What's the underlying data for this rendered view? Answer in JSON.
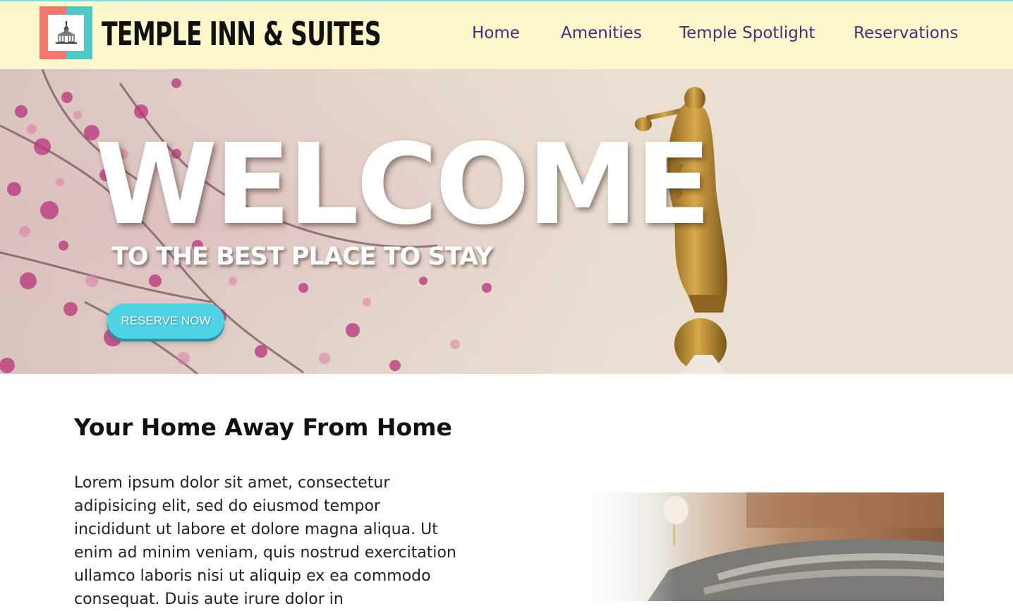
{
  "header": {
    "brand": "TEMPLE INN & SUITES",
    "logo_icon": "temple-icon",
    "nav": [
      {
        "label": "Home"
      },
      {
        "label": "Amenities"
      },
      {
        "label": "Temple Spotlight"
      },
      {
        "label": "Reservations"
      }
    ]
  },
  "hero": {
    "headline": "WELCOME",
    "tagline": "TO THE BEST PLACE TO STAY",
    "cta_label": "RESERVE NOW"
  },
  "intro": {
    "title": "Your Home Away From Home",
    "body": "Lorem ipsum dolor sit amet, consectetur adipisicing elit, sed do eiusmod tempor incididunt ut labore et dolore magna aliqua. Ut enim ad minim veniam, quis nostrud exercitation ullamco laboris nisi ut aliquip ex ea commodo consequat. Duis aute irure dolor in"
  },
  "colors": {
    "header_bg": "#fdf8cc",
    "nav_text": "#4a2e7a",
    "logo_coral": "#f4776e",
    "logo_teal": "#4cc9c4",
    "cta_bg": "#4fd3e6"
  }
}
